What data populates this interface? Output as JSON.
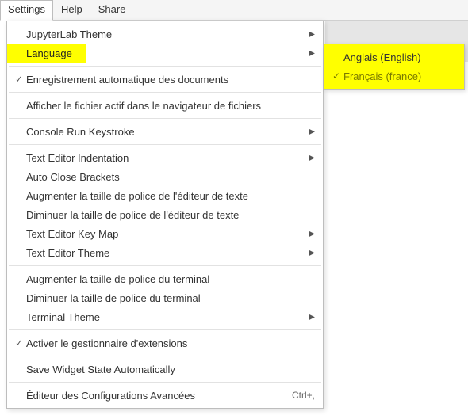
{
  "menubar": {
    "settings": "Settings",
    "help": "Help",
    "share": "Share"
  },
  "menu": {
    "jupyterlab_theme": "JupyterLab Theme",
    "language": "Language",
    "autosave_docs": "Enregistrement automatique des documents",
    "show_active_file": "Afficher le fichier actif dans le navigateur de fichiers",
    "console_run_keystroke": "Console Run Keystroke",
    "text_editor_indentation": "Text Editor Indentation",
    "auto_close_brackets": "Auto Close Brackets",
    "increase_editor_font": "Augmenter la taille de police de l'éditeur de texte",
    "decrease_editor_font": "Diminuer la taille de police de l'éditeur de texte",
    "text_editor_keymap": "Text Editor Key Map",
    "text_editor_theme": "Text Editor Theme",
    "increase_terminal_font": "Augmenter la taille de police du terminal",
    "decrease_terminal_font": "Diminuer la taille de police du terminal",
    "terminal_theme": "Terminal Theme",
    "enable_ext_manager": "Activer le gestionnaire d'extensions",
    "save_widget_state": "Save Widget State Automatically",
    "advanced_settings": "Éditeur des Configurations Avancées",
    "advanced_settings_shortcut": "Ctrl+,"
  },
  "submenu": {
    "english": "Anglais (English)",
    "french": "Français (france)"
  }
}
